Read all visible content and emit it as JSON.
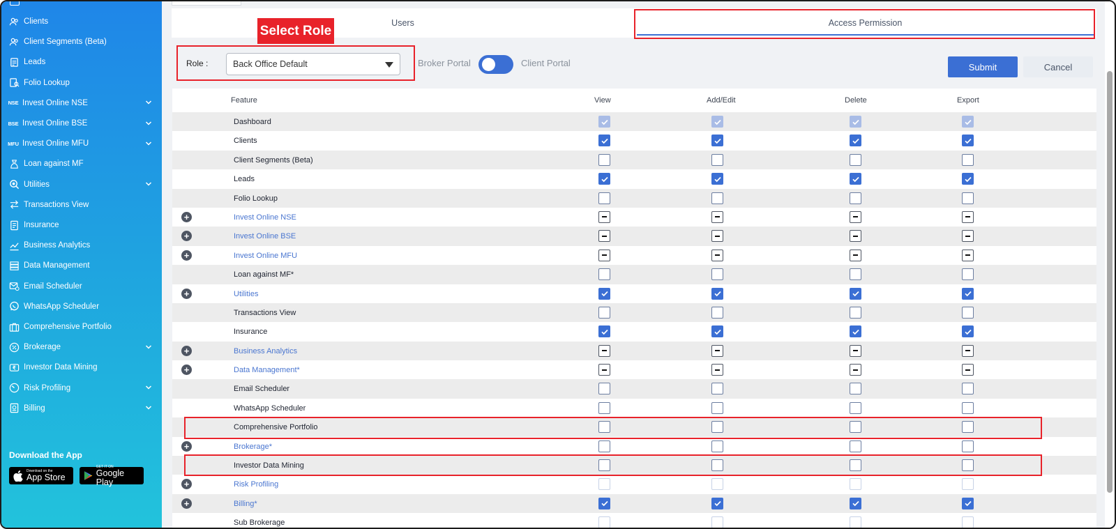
{
  "sidebar": {
    "items": [
      {
        "label": "Clients",
        "icon": "users-icon",
        "chevron": false
      },
      {
        "label": "Client Segments (Beta)",
        "icon": "users-icon",
        "chevron": false
      },
      {
        "label": "Leads",
        "icon": "leads-icon",
        "chevron": false
      },
      {
        "label": "Folio Lookup",
        "icon": "folio-lookup-icon",
        "chevron": false
      },
      {
        "label": "Invest Online NSE",
        "icon": "NSE",
        "chevron": true
      },
      {
        "label": "Invest Online BSE",
        "icon": "BSE",
        "chevron": true
      },
      {
        "label": "Invest Online MFU",
        "icon": "MFU",
        "chevron": true
      },
      {
        "label": "Loan against MF",
        "icon": "loan-icon",
        "chevron": false
      },
      {
        "label": "Utilities",
        "icon": "utilities-icon",
        "chevron": true
      },
      {
        "label": "Transactions View",
        "icon": "swap-icon",
        "chevron": false
      },
      {
        "label": "Insurance",
        "icon": "document-icon",
        "chevron": false
      },
      {
        "label": "Business Analytics",
        "icon": "chart-icon",
        "chevron": false
      },
      {
        "label": "Data Management",
        "icon": "database-icon",
        "chevron": false
      },
      {
        "label": "Email Scheduler",
        "icon": "email-icon",
        "chevron": false
      },
      {
        "label": "WhatsApp Scheduler",
        "icon": "whatsapp-icon",
        "chevron": false
      },
      {
        "label": "Comprehensive Portfolio",
        "icon": "briefcase-icon",
        "chevron": false
      },
      {
        "label": "Brokerage",
        "icon": "percent-icon",
        "chevron": true
      },
      {
        "label": "Investor Data Mining",
        "icon": "rupee-icon",
        "chevron": false
      },
      {
        "label": "Risk Profiling",
        "icon": "gauge-icon",
        "chevron": true
      },
      {
        "label": "Billing",
        "icon": "billing-icon",
        "chevron": true
      }
    ],
    "download_title": "Download the App",
    "app_store": {
      "small": "Download on the",
      "big": "App Store"
    },
    "google_play": {
      "small": "GET IT ON",
      "big": "Google Play"
    }
  },
  "tabs": [
    {
      "label": "Users",
      "active": false
    },
    {
      "label": "Access Permission",
      "active": true
    }
  ],
  "annotation_label": "Select Role",
  "role": {
    "label": "Role :",
    "selected": "Back Office Default"
  },
  "portal_toggle": {
    "left": "Broker Portal",
    "right": "Client Portal",
    "on": true
  },
  "buttons": {
    "submit": "Submit",
    "cancel": "Cancel"
  },
  "table": {
    "headers": {
      "feature": "Feature",
      "view": "View",
      "add_edit": "Add/Edit",
      "delete": "Delete",
      "export": "Export"
    },
    "rows": [
      {
        "feature": "Dashboard",
        "expandable": false,
        "state": "disabled"
      },
      {
        "feature": "Clients",
        "expandable": false,
        "state": "checked"
      },
      {
        "feature": "Client Segments (Beta)",
        "expandable": false,
        "state": "unchecked"
      },
      {
        "feature": "Leads",
        "expandable": false,
        "state": "checked"
      },
      {
        "feature": "Folio Lookup",
        "expandable": false,
        "state": "unchecked"
      },
      {
        "feature": "Invest Online NSE",
        "expandable": true,
        "state": "indeterminate"
      },
      {
        "feature": "Invest Online BSE",
        "expandable": true,
        "state": "indeterminate"
      },
      {
        "feature": "Invest Online MFU",
        "expandable": true,
        "state": "indeterminate"
      },
      {
        "feature": "Loan against MF*",
        "expandable": false,
        "state": "unchecked"
      },
      {
        "feature": "Utilities",
        "expandable": true,
        "state": "checked"
      },
      {
        "feature": "Transactions View",
        "expandable": false,
        "state": "unchecked"
      },
      {
        "feature": "Insurance",
        "expandable": false,
        "state": "checked"
      },
      {
        "feature": "Business Analytics",
        "expandable": true,
        "state": "indeterminate"
      },
      {
        "feature": "Data Management*",
        "expandable": true,
        "state": "indeterminate"
      },
      {
        "feature": "Email Scheduler",
        "expandable": false,
        "state": "unchecked"
      },
      {
        "feature": "WhatsApp Scheduler",
        "expandable": false,
        "state": "unchecked"
      },
      {
        "feature": "Comprehensive Portfolio",
        "expandable": false,
        "state": "unchecked"
      },
      {
        "feature": "Brokerage*",
        "expandable": true,
        "state": "unchecked"
      },
      {
        "feature": "Investor Data Mining",
        "expandable": false,
        "state": "unchecked"
      },
      {
        "feature": "Risk Profiling",
        "expandable": true,
        "state": "faint"
      },
      {
        "feature": "Billing*",
        "expandable": true,
        "state": "checked"
      },
      {
        "feature": "Sub Brokerage",
        "expandable": false,
        "state": "faint"
      }
    ]
  },
  "colors": {
    "accent": "#3b6fd4",
    "annotation": "#e8222a",
    "sidebar_top": "#1f86e8",
    "sidebar_bottom": "#22c3dc"
  }
}
